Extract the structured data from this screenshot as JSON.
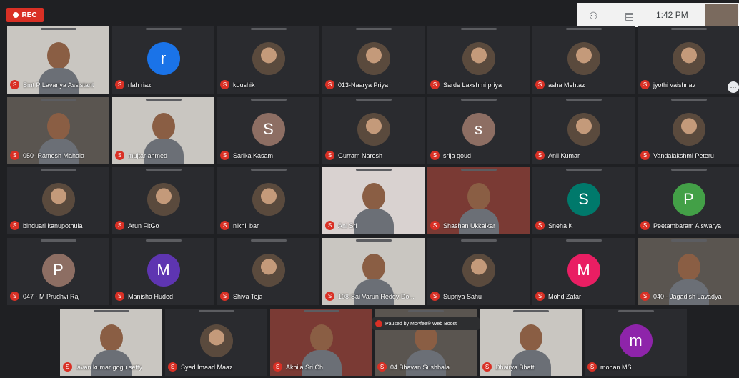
{
  "recording": {
    "label": "REC"
  },
  "topbar": {
    "people_icon": "people-icon",
    "chat_icon": "chat-icon",
    "time": "1:42 PM"
  },
  "paused_banner": {
    "text": "Paused by McAfee® Web Boost"
  },
  "participants": [
    {
      "name": "Smt P Lavanya Assistant",
      "type": "video"
    },
    {
      "name": "rfah riaz",
      "type": "avatar",
      "letter": "r",
      "color": "#1a73e8"
    },
    {
      "name": "koushik",
      "type": "photo"
    },
    {
      "name": "013-Naarya Priya",
      "type": "photo"
    },
    {
      "name": "Sarde Lakshmi priya",
      "type": "photo"
    },
    {
      "name": "asha Mehtaz",
      "type": "photo"
    },
    {
      "name": "jyothi vaishnav",
      "type": "photo"
    },
    {
      "name": "050- Ramesh Mahala",
      "type": "video"
    },
    {
      "name": "mujtar ahmed",
      "type": "video"
    },
    {
      "name": "Sarika Kasam",
      "type": "avatar",
      "letter": "S",
      "color": "#8d6e63"
    },
    {
      "name": "Gurram Naresh",
      "type": "photo"
    },
    {
      "name": "srija goud",
      "type": "avatar",
      "letter": "s",
      "color": "#8d6e63"
    },
    {
      "name": "Anil Kumar",
      "type": "photo"
    },
    {
      "name": "Vandalakshmi Peteru",
      "type": "photo"
    },
    {
      "name": "binduari kanupothula",
      "type": "photo"
    },
    {
      "name": "Arun FitGo",
      "type": "photo"
    },
    {
      "name": "nikhil bar",
      "type": "photo"
    },
    {
      "name": "Ani Sri",
      "type": "video"
    },
    {
      "name": "Shashan Ukkalkar",
      "type": "video"
    },
    {
      "name": "Sneha K",
      "type": "avatar",
      "letter": "S",
      "color": "#00796b"
    },
    {
      "name": "Peetambaram Aiswarya",
      "type": "avatar",
      "letter": "P",
      "color": "#43a047"
    },
    {
      "name": "047 - M Prudhvi Raj",
      "type": "avatar",
      "letter": "P",
      "color": "#8d6e63"
    },
    {
      "name": "Manisha Huded",
      "type": "avatar",
      "letter": "M",
      "color": "#5e35b1"
    },
    {
      "name": "Shiva Teja",
      "type": "photo"
    },
    {
      "name": "108-Sai Varun Reddy Do...",
      "type": "video"
    },
    {
      "name": "Supriya Sahu",
      "type": "photo"
    },
    {
      "name": "Mohd Zafar",
      "type": "avatar",
      "letter": "M",
      "color": "#e91e63"
    },
    {
      "name": "040 - Jagadish Lavadya",
      "type": "video"
    },
    {
      "name": "lavan kumar gogu setty",
      "type": "video"
    },
    {
      "name": "Syed Imaad Maaz",
      "type": "photo"
    },
    {
      "name": "Akhila Sri Ch",
      "type": "video"
    },
    {
      "name": "04 Bhavan Sushbala",
      "type": "video"
    },
    {
      "name": "Dhairya Bhatt",
      "type": "video"
    },
    {
      "name": "mohan MS",
      "type": "avatar",
      "letter": "m",
      "color": "#8e24aa"
    }
  ]
}
